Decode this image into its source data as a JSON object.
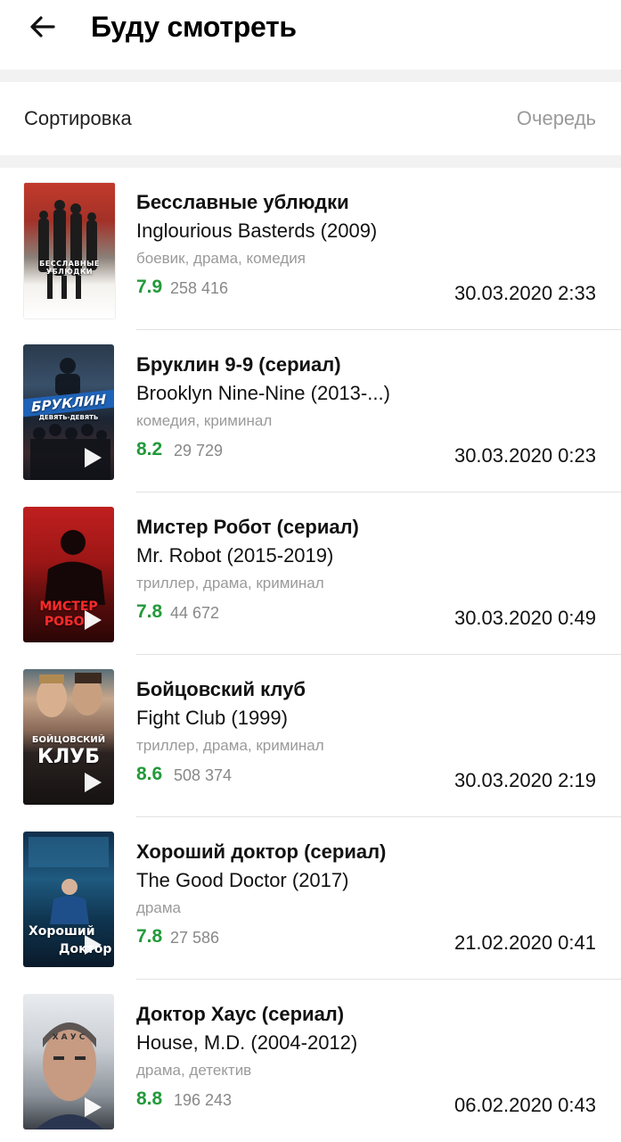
{
  "header": {
    "title": "Буду смотреть"
  },
  "sort": {
    "label": "Сортировка",
    "value": "Очередь"
  },
  "items": [
    {
      "name": "Бесславные ублюдки",
      "original": "Inglourious Basterds (2009)",
      "genres": "боевик, драма, комедия",
      "rating": "7.9",
      "votes": "258 416",
      "date": "30.03.2020 2:33",
      "poster_text": "БЕССЛАВНЫЕ УБЛЮДКИ",
      "has_trailer": false
    },
    {
      "name": "Бруклин 9-9 (сериал)",
      "original": "Brooklyn Nine-Nine (2013-...)",
      "genres": "комедия, криминал",
      "rating": "8.2",
      "votes": "29 729",
      "date": "30.03.2020 0:23",
      "poster_text": "БРУКЛИН",
      "poster_subtext": "ДЕВЯТЬ-ДЕВЯТЬ",
      "has_trailer": true
    },
    {
      "name": "Мистер Робот (сериал)",
      "original": "Mr. Robot (2015-2019)",
      "genres": "триллер, драма, криминал",
      "rating": "7.8",
      "votes": "44 672",
      "date": "30.03.2020 0:49",
      "poster_text": "МИСТЕР",
      "poster_subtext": "РОБОТ",
      "has_trailer": true
    },
    {
      "name": "Бойцовский клуб",
      "original": "Fight Club (1999)",
      "genres": "триллер, драма, криминал",
      "rating": "8.6",
      "votes": "508 374",
      "date": "30.03.2020 2:19",
      "poster_text": "БОЙЦОВСКИЙ",
      "poster_subtext": "КЛУБ",
      "has_trailer": true
    },
    {
      "name": "Хороший доктор (сериал)",
      "original": "The Good Doctor (2017)",
      "genres": "драма",
      "rating": "7.8",
      "votes": "27 586",
      "date": "21.02.2020 0:41",
      "poster_text": "Хороший",
      "poster_subtext": "Доктор",
      "has_trailer": true
    },
    {
      "name": "Доктор Хаус (сериал)",
      "original": "House, M.D. (2004-2012)",
      "genres": "драма, детектив",
      "rating": "8.8",
      "votes": "196 243",
      "date": "06.02.2020 0:43",
      "poster_text": "Х А У С",
      "has_trailer": true
    }
  ],
  "colors": {
    "rating": "#229a3a",
    "muted": "#9a9a9a",
    "separator": "#f2f2f2"
  },
  "icons": {
    "back": "arrow-left-icon",
    "play": "play-icon"
  }
}
